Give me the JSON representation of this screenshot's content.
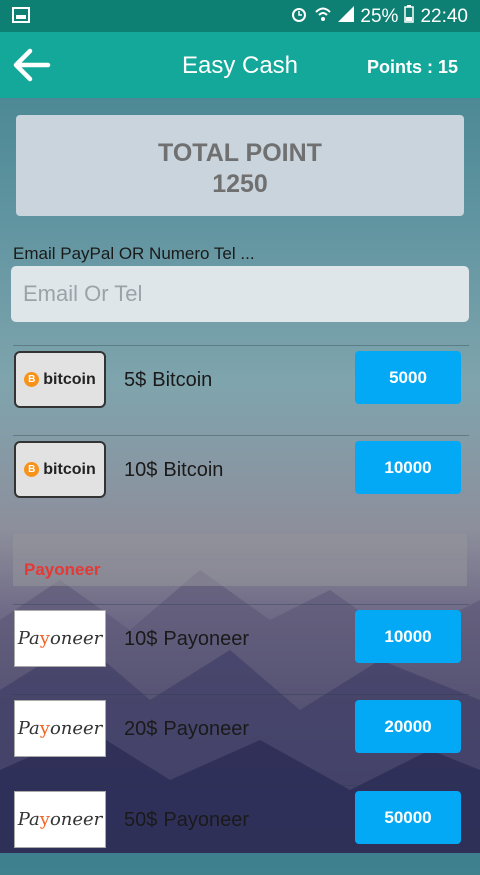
{
  "status_bar": {
    "battery": "25%",
    "time": "22:40"
  },
  "app_bar": {
    "title": "Easy Cash",
    "points": "Points : 15"
  },
  "total": {
    "label": "TOTAL POINT",
    "value": "1250"
  },
  "email": {
    "label": "Email PayPal OR Numero Tel ...",
    "placeholder": "Email Or Tel"
  },
  "bitcoin_logo": "bitcoin",
  "payoneer_logo": {
    "pre": "Pa",
    "v": "y",
    "post": "oneer"
  },
  "section_payoneer": "Payoneer",
  "offers": [
    {
      "amount": "5$",
      "name": "Bitcoin",
      "cost": "5000"
    },
    {
      "amount": "10$",
      "name": "Bitcoin",
      "cost": "10000"
    },
    {
      "amount": "10$",
      "name": "Payoneer",
      "cost": "10000"
    },
    {
      "amount": "20$",
      "name": "Payoneer",
      "cost": "20000"
    },
    {
      "amount": "50$",
      "name": "Payoneer",
      "cost": "50000"
    }
  ]
}
